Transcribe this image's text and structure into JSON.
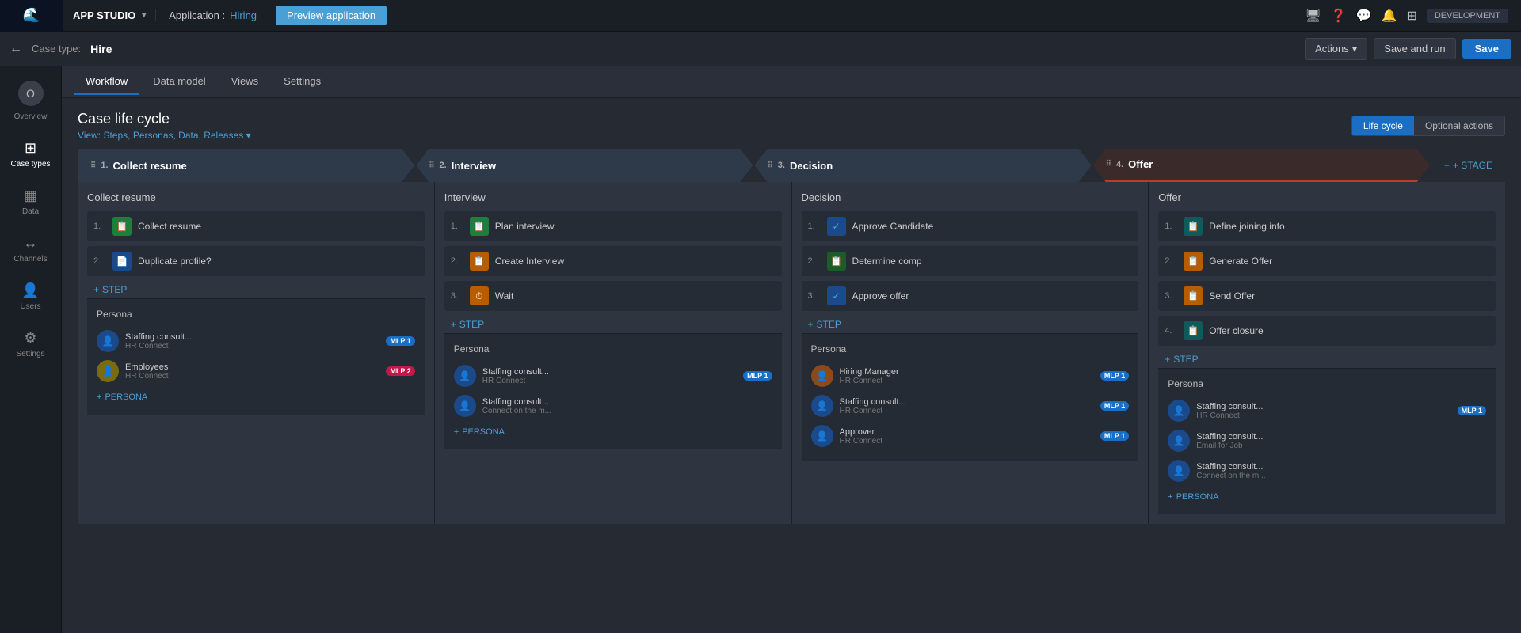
{
  "app": {
    "logo": "🌊",
    "studio_label": "APP STUDIO",
    "chevron": "▾",
    "application_label": "Application :",
    "application_name": "Hiring",
    "preview_label": "Preview application",
    "dev_badge": "DEVELOPMENT"
  },
  "topnav_icons": [
    "🖥",
    "❓",
    "💬",
    "🔔",
    "⊞"
  ],
  "second_bar": {
    "back_icon": "←",
    "case_type_label": "Case type:",
    "case_type_name": "Hire",
    "actions_label": "Actions",
    "save_run_label": "Save and run",
    "save_label": "Save"
  },
  "sidebar": {
    "items": [
      {
        "id": "overview",
        "label": "Overview",
        "icon": "⊙"
      },
      {
        "id": "case-types",
        "label": "Case types",
        "icon": "⊞"
      },
      {
        "id": "data",
        "label": "Data",
        "icon": "▦"
      },
      {
        "id": "channels",
        "label": "Channels",
        "icon": "↔"
      },
      {
        "id": "users",
        "label": "Users",
        "icon": "👤"
      },
      {
        "id": "settings",
        "label": "Settings",
        "icon": "⚙"
      }
    ]
  },
  "tabs": [
    {
      "id": "workflow",
      "label": "Workflow",
      "active": true
    },
    {
      "id": "data-model",
      "label": "Data model",
      "active": false
    },
    {
      "id": "views",
      "label": "Views",
      "active": false
    },
    {
      "id": "settings",
      "label": "Settings",
      "active": false
    }
  ],
  "lifecycle": {
    "title": "Case life cycle",
    "view_prefix": "View:",
    "view_options": "Steps, Personas, Data, Releases",
    "toggle_left": "Life cycle",
    "toggle_right": "Optional actions"
  },
  "stages": [
    {
      "id": "collect-resume",
      "num": "1.",
      "label": "Collect resume",
      "color": "collect",
      "steps": [
        {
          "num": "1.",
          "icon": "green",
          "icon_char": "📋",
          "label": "Collect resume"
        },
        {
          "num": "2.",
          "icon": "blue",
          "icon_char": "📄",
          "label": "Duplicate profile?"
        }
      ],
      "add_step": "+ STEP",
      "persona_title": "Persona",
      "personas": [
        {
          "name": "Staffing consult...",
          "sub": "HR Connect",
          "avatar": "blue",
          "mlp": "MLP 1",
          "mlp_color": "blue"
        },
        {
          "name": "Employees",
          "sub": "HR Connect",
          "avatar": "yellow",
          "mlp": "MLP 2",
          "mlp_color": "pink"
        }
      ],
      "add_persona": "+ PERSONA"
    },
    {
      "id": "interview",
      "num": "2.",
      "label": "Interview",
      "color": "interview",
      "steps": [
        {
          "num": "1.",
          "icon": "green",
          "icon_char": "📋",
          "label": "Plan interview"
        },
        {
          "num": "2.",
          "icon": "orange",
          "icon_char": "📋",
          "label": "Create Interview"
        },
        {
          "num": "3.",
          "icon": "orange",
          "icon_char": "⏱",
          "label": "Wait"
        }
      ],
      "add_step": "+ STEP",
      "persona_title": "Persona",
      "personas": [
        {
          "name": "Staffing consult...",
          "sub": "HR Connect",
          "avatar": "blue",
          "mlp": "MLP 1",
          "mlp_color": "blue"
        },
        {
          "name": "Staffing consult...",
          "sub": "Connect on the m...",
          "avatar": "blue",
          "mlp": null
        }
      ],
      "add_persona": "+ PERSONA"
    },
    {
      "id": "decision",
      "num": "3.",
      "label": "Decision",
      "color": "decision",
      "steps": [
        {
          "num": "1.",
          "icon": "check",
          "icon_char": "✓",
          "label": "Approve Candidate"
        },
        {
          "num": "2.",
          "icon": "dark-green",
          "icon_char": "📋",
          "label": "Determine comp"
        },
        {
          "num": "3.",
          "icon": "check",
          "icon_char": "✓",
          "label": "Approve offer"
        }
      ],
      "add_step": "+ STEP",
      "persona_title": "Persona",
      "personas": [
        {
          "name": "Hiring Manager",
          "sub": "HR Connect",
          "avatar": "orange",
          "mlp": "MLP 1",
          "mlp_color": "blue"
        },
        {
          "name": "Staffing consult...",
          "sub": "HR Connect",
          "avatar": "blue",
          "mlp": "MLP 1",
          "mlp_color": "blue"
        },
        {
          "name": "Approver",
          "sub": "HR Connect",
          "avatar": "blue",
          "mlp": "MLP 1",
          "mlp_color": "blue"
        }
      ],
      "add_persona": "+ PERSONA"
    },
    {
      "id": "offer",
      "num": "4.",
      "label": "Offer",
      "color": "offer",
      "steps": [
        {
          "num": "1.",
          "icon": "teal",
          "icon_char": "📋",
          "label": "Define joining info"
        },
        {
          "num": "2.",
          "icon": "orange",
          "icon_char": "📋",
          "label": "Generate Offer"
        },
        {
          "num": "3.",
          "icon": "orange",
          "icon_char": "📋",
          "label": "Send Offer"
        },
        {
          "num": "4.",
          "icon": "teal",
          "icon_char": "📋",
          "label": "Offer closure"
        }
      ],
      "add_step": "+ STEP",
      "persona_title": "Persona",
      "personas": [
        {
          "name": "Staffing consult...",
          "sub": "HR Connect",
          "avatar": "blue",
          "mlp": "MLP 1",
          "mlp_color": "blue"
        },
        {
          "name": "Staffing consult...",
          "sub": "Email for Job",
          "avatar": "blue",
          "mlp": null
        },
        {
          "name": "Staffing consult...",
          "sub": "Connect on the m...",
          "avatar": "blue",
          "mlp": null
        }
      ],
      "add_persona": "+ PERSONA"
    }
  ],
  "add_stage": "+ STAGE"
}
